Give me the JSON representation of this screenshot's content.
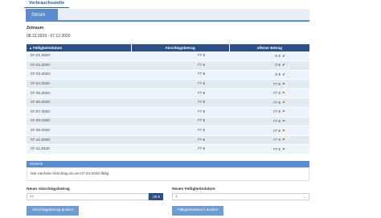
{
  "top_tabs": [
    {
      "label": "Verbrauchsstelle"
    },
    {
      "label": ""
    }
  ],
  "section_tab": "Strom",
  "zeitraum": {
    "label": "Zeitraum",
    "value": "08.12.2019 - 07.12.2020"
  },
  "table": {
    "headers": [
      "Fälligkeitsdatum",
      "Abschlagsbetrag",
      "offener Betrag"
    ],
    "rows": [
      {
        "date": "07.01.2020",
        "amount": "77 €",
        "open": "0 €",
        "status": "paid"
      },
      {
        "date": "07.02.2020",
        "amount": "77 €",
        "open": "0 €",
        "status": "paid"
      },
      {
        "date": "07.03.2020",
        "amount": "77 €",
        "open": "0 €",
        "status": "paid"
      },
      {
        "date": "07.04.2020",
        "amount": "77 €",
        "open": "77 €",
        "status": "open"
      },
      {
        "date": "07.05.2020",
        "amount": "77 €",
        "open": "77 €",
        "status": "open"
      },
      {
        "date": "07.06.2020",
        "amount": "77 €",
        "open": "77 €",
        "status": "open"
      },
      {
        "date": "07.07.2020",
        "amount": "77 €",
        "open": "77 €",
        "status": "open"
      },
      {
        "date": "07.08.2020",
        "amount": "77 €",
        "open": "77 €",
        "status": "open"
      },
      {
        "date": "07.09.2020",
        "amount": "77 €",
        "open": "77 €",
        "status": "open"
      },
      {
        "date": "07.10.2020",
        "amount": "77 €",
        "open": "77 €",
        "status": "open"
      },
      {
        "date": "07.11.2020",
        "amount": "77 €",
        "open": "77 €",
        "status": "open"
      }
    ],
    "icons": {
      "paid": "✔",
      "open": "⚑"
    }
  },
  "hinweis": {
    "title": "Hinweis",
    "text": "Der nächste Abschlag ist am 07.04.2020 fällig."
  },
  "form": {
    "amount_label": "Neuer Abschlagsbetrag",
    "amount_value": "77",
    "amount_suffix": ",00 €",
    "date_label": "Neues Fälligkeitsdatum",
    "date_value": "7.",
    "chevron": "⌄",
    "amount_button": "Abschlagsbetrag ändern",
    "date_button": "Fälligkeitsdatum ändern"
  },
  "colors": {
    "header_dark": "#2c4f86",
    "accent": "#5b8ccc",
    "button": "#6f9ad2"
  }
}
